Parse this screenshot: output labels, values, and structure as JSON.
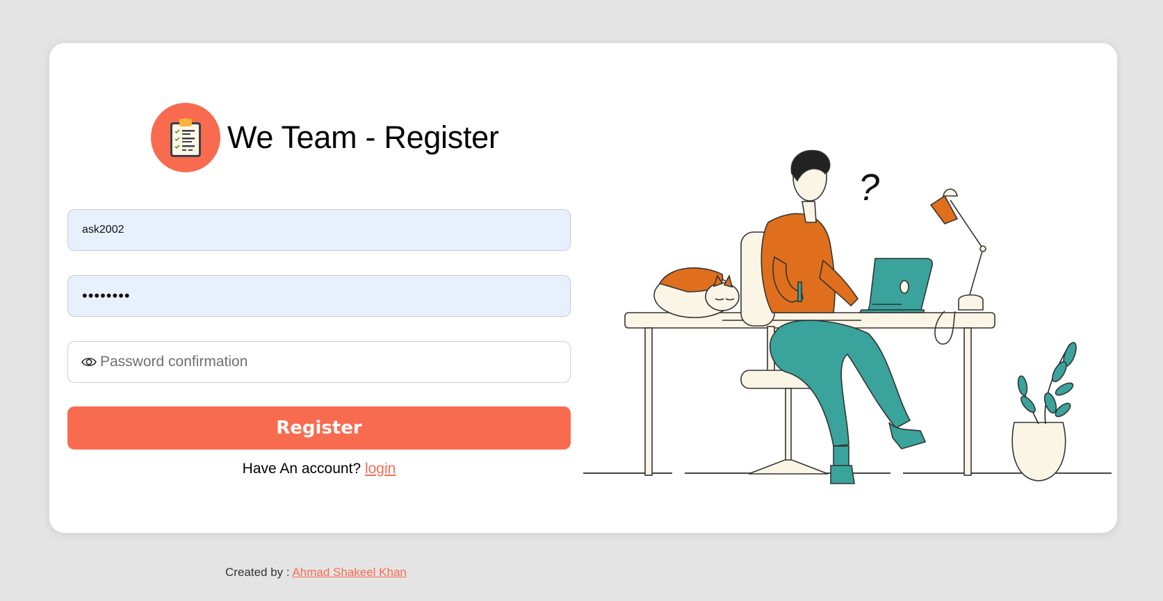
{
  "brand": {
    "title": "We Team - Register",
    "logo_icon": "clipboard-checklist-icon",
    "accent_color": "#f96b4f"
  },
  "form": {
    "username": {
      "value": "ask2002",
      "placeholder": ""
    },
    "password": {
      "value": "••••••••",
      "placeholder": ""
    },
    "password_confirmation": {
      "value": "",
      "placeholder": "Password confirmation",
      "icon": "eye-icon"
    },
    "register_label": "Register",
    "account_prompt": "Have An account?",
    "login_label": "login"
  },
  "illustration": {
    "question_mark": "?"
  },
  "footer": {
    "prefix": "Created by :",
    "author": "Ahmad Shakeel Khan"
  }
}
